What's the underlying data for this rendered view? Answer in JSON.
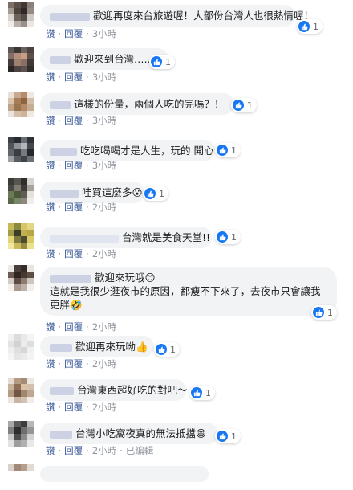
{
  "actions": {
    "like": "讚",
    "reply": "回覆",
    "edited": "已編輯"
  },
  "comments": [
    {
      "text": "歡迎再度來台旅遊喔！大部份台灣人也很熱情喔！",
      "line2": "",
      "reaction_count": "1",
      "time": "3小時",
      "edited": false,
      "emoji": ""
    },
    {
      "text": "歡迎來到台灣……",
      "line2": "",
      "reaction_count": "1",
      "time": "3小時",
      "edited": false,
      "emoji": ""
    },
    {
      "text": "這樣的份量，兩個人吃的完嗎？！",
      "line2": "",
      "reaction_count": "1",
      "time": "3小時",
      "edited": false,
      "emoji": ""
    },
    {
      "text": "吃吃喝喝才是人生，玩的 開心",
      "line2": "",
      "reaction_count": "1",
      "time": "3小時",
      "edited": false,
      "emoji": ""
    },
    {
      "text": "哇買這麼多",
      "line2": "",
      "reaction_count": "1",
      "time": "2小時",
      "edited": false,
      "emoji": "😮"
    },
    {
      "text": "台灣就是美食天堂!!",
      "line2": "",
      "reaction_count": "1",
      "time": "2小時",
      "edited": false,
      "emoji": ""
    },
    {
      "text": "歡迎來玩哦",
      "line2": "這就是我很少逛夜市的原因，都瘦不下來了，去夜市只會讓我更胖",
      "reaction_count": "1",
      "time": "2小時",
      "edited": false,
      "emoji": "😊",
      "emoji2": "🤣"
    },
    {
      "text": "歡迎再來玩呦",
      "line2": "",
      "reaction_count": "1",
      "time": "2小時",
      "edited": false,
      "emoji": "👍"
    },
    {
      "text": "台灣東西超好吃的對吧～",
      "line2": "",
      "reaction_count": "1",
      "time": "2小時",
      "edited": false,
      "emoji": ""
    },
    {
      "text": "台灣小吃窩夜真的無法抵擋",
      "line2": "",
      "reaction_count": "1",
      "time": "2小時",
      "edited": true,
      "emoji": "😄"
    }
  ],
  "colors": {
    "link": "#385898",
    "bubble": "#f2f3f5",
    "like_blue": "#1877f2",
    "meta_gray": "#90949c"
  }
}
